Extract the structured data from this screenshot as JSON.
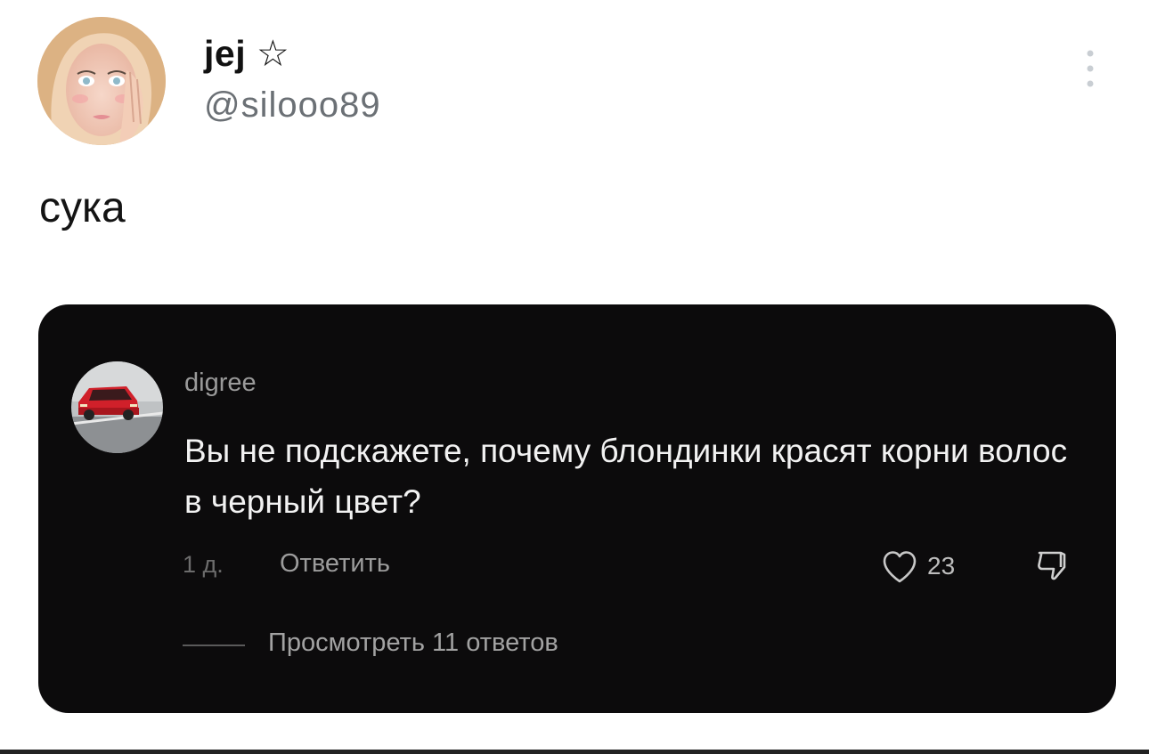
{
  "post": {
    "author": {
      "display_name": "jej ☆",
      "handle": "@silooo89"
    },
    "text": "сука",
    "more_icon": "more-vertical-icon"
  },
  "quoted_comment": {
    "author": "digree",
    "text": "Вы не подскажете, почему блондинки красят корни волос в черный цвет?",
    "time": "1 д.",
    "reply_label": "Ответить",
    "like_icon": "heart-icon",
    "likes": "23",
    "dislike_icon": "thumbs-down-icon",
    "view_replies_label": "Просмотреть 11 ответов"
  }
}
